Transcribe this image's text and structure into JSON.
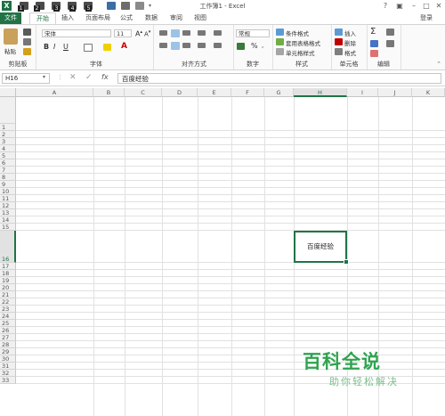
{
  "window": {
    "title": "工作簿1 - Excel",
    "help": "?",
    "login": "登录"
  },
  "quick_access": {
    "badges": [
      "1",
      "2",
      "3",
      "4",
      "5"
    ]
  },
  "tabs": [
    "文件",
    "开始",
    "插入",
    "页面布局",
    "公式",
    "数据",
    "审阅",
    "视图"
  ],
  "ribbon": {
    "clipboard": {
      "label": "剪贴板",
      "paste": "粘贴"
    },
    "font": {
      "label": "字体",
      "name": "宋体",
      "size": "11",
      "bold": "B",
      "italic": "I",
      "underline": "U"
    },
    "alignment": {
      "label": "对齐方式"
    },
    "number": {
      "label": "数字",
      "format": "常规",
      "percent": "%"
    },
    "styles": {
      "label": "样式",
      "items": [
        "条件格式",
        "套用表格格式",
        "单元格样式"
      ]
    },
    "cells": {
      "label": "单元格",
      "items": [
        "插入",
        "删除",
        "格式"
      ]
    },
    "editing": {
      "label": "编辑",
      "sum": "Σ"
    }
  },
  "formula_bar": {
    "name_box": "H16",
    "fx": "fx",
    "content": "百度经验"
  },
  "grid": {
    "columns": [
      "A",
      "B",
      "C",
      "D",
      "E",
      "F",
      "G",
      "H",
      "I",
      "J",
      "K"
    ],
    "rows": [
      "1",
      "2",
      "3",
      "4",
      "5",
      "6",
      "7",
      "8",
      "9",
      "10",
      "11",
      "12",
      "13",
      "14",
      "15",
      "16",
      "17",
      "18",
      "19",
      "20",
      "21",
      "22",
      "23",
      "24",
      "25",
      "26",
      "27",
      "28",
      "29",
      "30",
      "31",
      "32",
      "33"
    ],
    "active_cell": "H16",
    "active_value": "百度经验"
  },
  "watermark": {
    "logo": "百科全说",
    "sub": "助你轻松解决"
  },
  "colors": {
    "accent": "#217346",
    "watermark": "#2ea44f"
  }
}
